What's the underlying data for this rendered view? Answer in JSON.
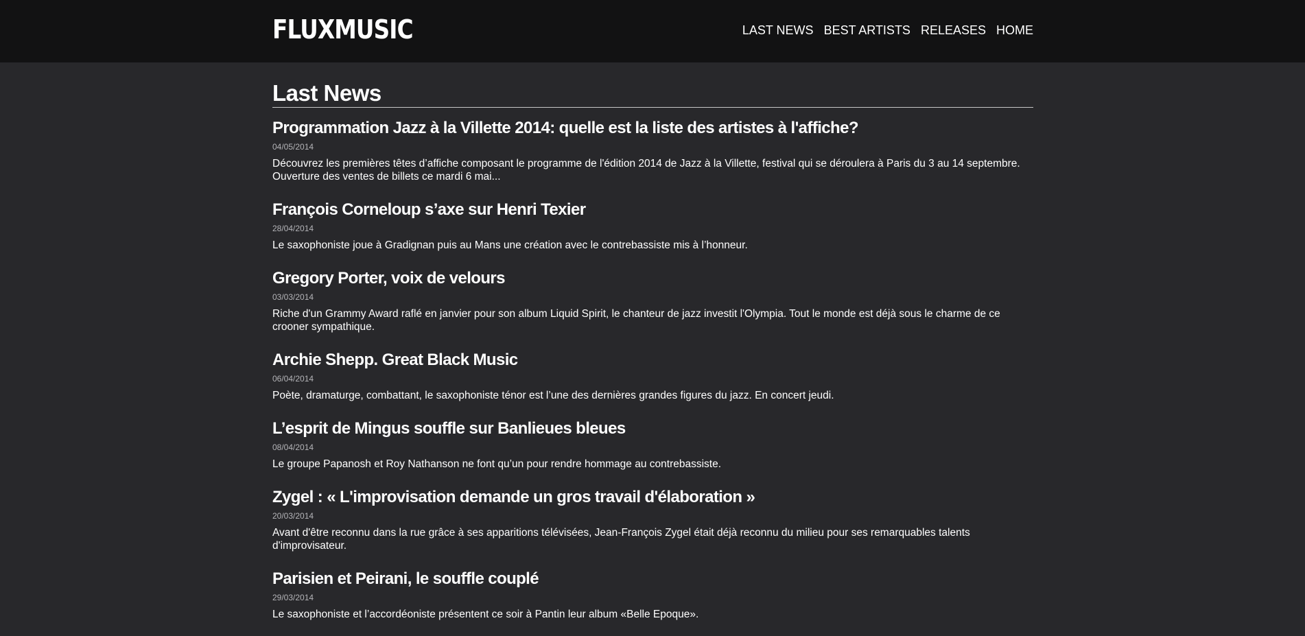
{
  "header": {
    "logo": "FLUXMUSIC",
    "nav": [
      "LAST NEWS",
      "BEST ARTISTS",
      "RELEASES",
      "HOME"
    ]
  },
  "page": {
    "title": "Last News"
  },
  "articles": [
    {
      "title": "Programmation Jazz à la Villette 2014: quelle est la liste des artistes à l'affiche?",
      "date": "04/05/2014",
      "text": "Découvrez les premières têtes d’affiche composant le programme de l'édition 2014 de Jazz à la Villette, festival qui se déroulera à Paris du 3 au 14 septembre. Ouverture des ventes de billets ce mardi 6 mai..."
    },
    {
      "title": "François Corneloup s’axe sur Henri Texier",
      "date": "28/04/2014",
      "text": "Le saxophoniste joue à Gradignan puis au Mans une création avec le contrebassiste mis à l’honneur."
    },
    {
      "title": "Gregory Porter, voix de velours",
      "date": "03/03/2014",
      "text": "Riche d'un Grammy Award raflé en janvier pour son album Liquid Spirit, le chanteur de jazz investit l'Olympia. Tout le monde est déjà sous le charme de ce crooner sympathique."
    },
    {
      "title": "Archie Shepp. Great Black Music",
      "date": "06/04/2014",
      "text": "Poète, dramaturge, combattant, le saxophoniste ténor est l’une des dernières grandes figures du jazz. En concert jeudi."
    },
    {
      "title": "L’esprit de Mingus souffle sur Banlieues bleues",
      "date": "08/04/2014",
      "text": "Le groupe Papanosh et Roy Nathanson ne font qu’un pour rendre hommage au contrebassiste."
    },
    {
      "title": "Zygel : « L'improvisation demande un gros travail d'élaboration »",
      "date": "20/03/2014",
      "text": "Avant d'être reconnu dans la rue grâce à ses apparitions télévisées, Jean-François Zygel était déjà reconnu du milieu pour ses remarquables talents d'improvisateur."
    },
    {
      "title": "Parisien et Peirani, le souffle couplé",
      "date": "29/03/2014",
      "text": "Le saxophoniste et l’accordéoniste présentent ce soir à Pantin leur album «Belle Epoque»."
    }
  ]
}
